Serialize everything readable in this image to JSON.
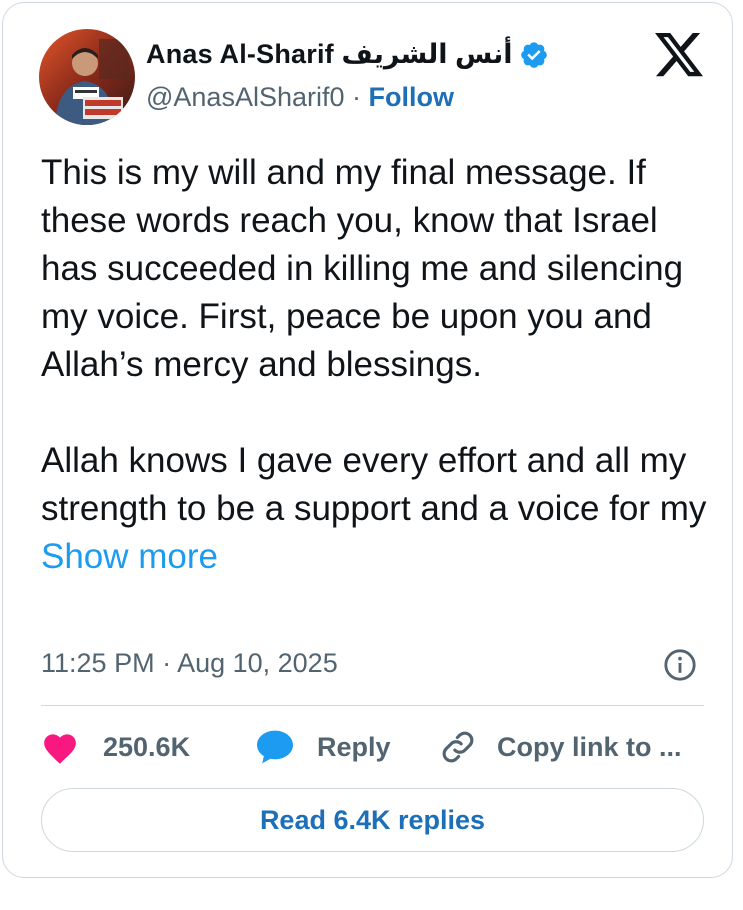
{
  "author": {
    "display_name": "Anas Al-Sharif أنس الشريف",
    "handle": "@AnasAlSharif0",
    "separator": "·",
    "follow_label": "Follow"
  },
  "tweet": {
    "paragraph_1": "This is my will and my final message. If these words reach you, know that Israel has succeeded in killing me and silencing my voice. First, peace be upon you and Allah’s mercy and blessings.",
    "paragraph_2": "Allah knows I gave every effort and all my strength to be a support and a voice for my",
    "show_more_label": "Show more",
    "timestamp": "11:25 PM · Aug 10, 2025"
  },
  "actions": {
    "likes": "250.6K",
    "reply_label": "Reply",
    "copy_link_label": "Copy link to ..."
  },
  "read_replies_label": "Read 6.4K replies",
  "colors": {
    "text_primary": "#0f1419",
    "text_secondary": "#536471",
    "link_blue": "#1d9bf0",
    "follow_blue": "#1d6fb8",
    "like_pink": "#f91880",
    "reply_blue": "#1d9bf0",
    "border": "#cfd9de"
  },
  "icons": {
    "verified": "verified-badge-icon",
    "x_logo": "x-logo-icon",
    "info": "info-icon",
    "like": "heart-icon",
    "reply": "speech-bubble-icon",
    "copy_link": "link-icon"
  }
}
